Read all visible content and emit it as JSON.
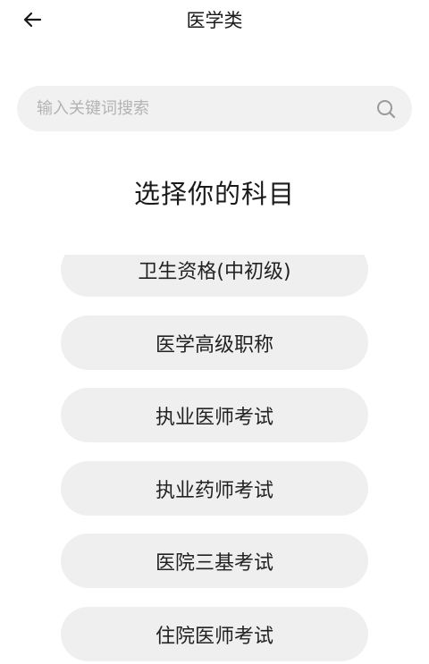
{
  "header": {
    "title": "医学类",
    "back_icon": "arrow-left-icon"
  },
  "search": {
    "placeholder": "输入关键词搜索",
    "value": "",
    "icon": "search-icon"
  },
  "section": {
    "heading": "选择你的科目"
  },
  "subjects": [
    {
      "label": "卫生资格(中初级)"
    },
    {
      "label": "医学高级职称"
    },
    {
      "label": "执业医师考试"
    },
    {
      "label": "执业药师考试"
    },
    {
      "label": "医院三基考试"
    },
    {
      "label": "住院医师考试"
    }
  ],
  "colors": {
    "background": "#ffffff",
    "pill": "#efefef",
    "search_bg": "#f1f1f1",
    "placeholder": "#b3b3b3",
    "text": "#1a1a1a"
  }
}
